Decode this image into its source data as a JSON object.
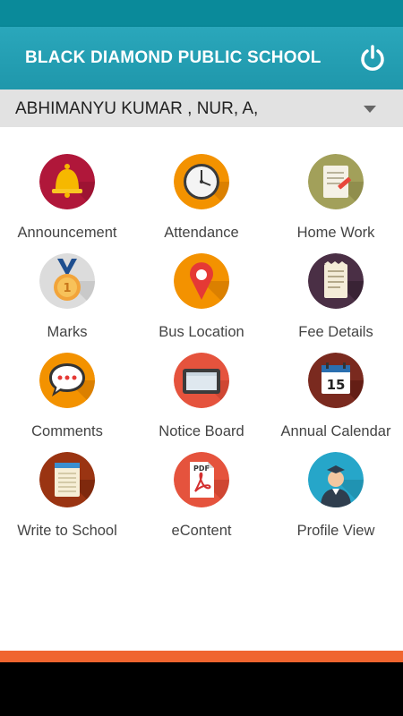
{
  "app": {
    "title": "BLACK DIAMOND PUBLIC SCHOOL"
  },
  "student_selector": {
    "selected": "ABHIMANYU KUMAR , NUR, A,"
  },
  "menu": [
    {
      "label": "Announcement",
      "icon": "bell-icon"
    },
    {
      "label": "Attendance",
      "icon": "clock-icon"
    },
    {
      "label": "Home Work",
      "icon": "homework-notepad-icon"
    },
    {
      "label": "Marks",
      "icon": "medal-icon"
    },
    {
      "label": "Bus Location",
      "icon": "map-pin-icon"
    },
    {
      "label": "Fee Details",
      "icon": "receipt-icon"
    },
    {
      "label": "Comments",
      "icon": "speech-bubble-icon"
    },
    {
      "label": "Notice Board",
      "icon": "notice-board-icon"
    },
    {
      "label": "Annual Calendar",
      "icon": "calendar-icon",
      "calendar_day": "15"
    },
    {
      "label": "Write to School",
      "icon": "notebook-icon"
    },
    {
      "label": "eContent",
      "icon": "pdf-file-icon",
      "badge": "PDF"
    },
    {
      "label": "Profile View",
      "icon": "user-profile-icon"
    }
  ],
  "colors": {
    "status_bar": "#0a8a9a",
    "app_bar": "#2aa7bb",
    "student_bar": "#e2e2e2",
    "bottom_accent": "#f0652f"
  }
}
